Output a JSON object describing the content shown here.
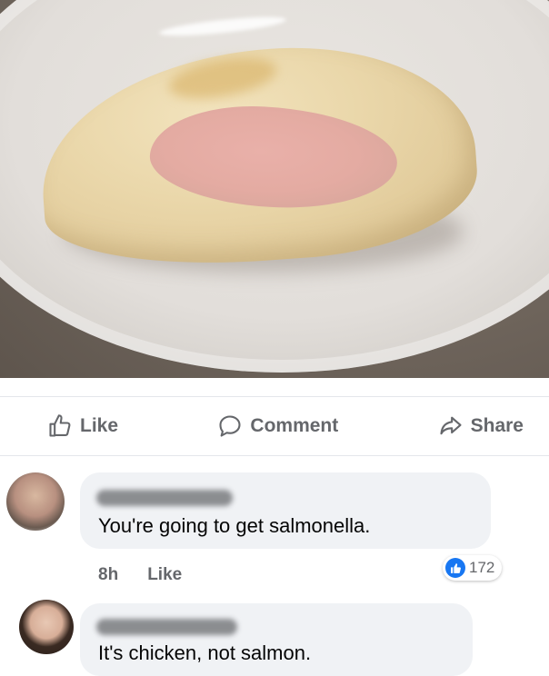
{
  "post": {
    "image_description_icon": "photo"
  },
  "actions": {
    "like_label": "Like",
    "comment_label": "Comment",
    "share_label": "Share"
  },
  "comments": [
    {
      "text": "You're going to get salmonella.",
      "time": "8h",
      "like_label": "Like",
      "reaction_count": "172"
    },
    {
      "text": "It's chicken, not salmon."
    }
  ],
  "colors": {
    "facebook_blue": "#1877f2",
    "bubble_bg": "#f0f2f5",
    "secondary_text": "#65676b"
  }
}
